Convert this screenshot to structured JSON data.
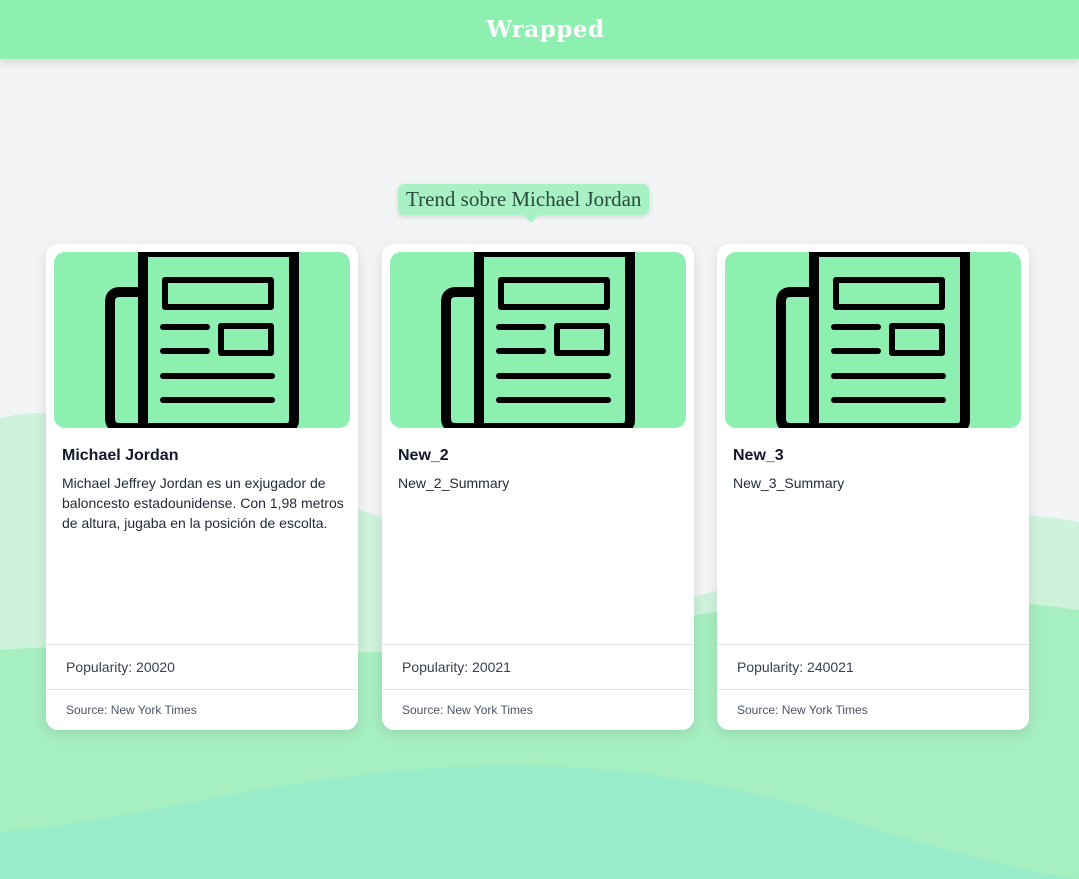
{
  "header": {
    "title": "Wrapped"
  },
  "trend": {
    "label": "Trend sobre Michael Jordan"
  },
  "colors": {
    "accent": "#8ef0b0",
    "bubble": "#a8f1c4",
    "background": "#f3f4f5"
  },
  "cards": [
    {
      "icon": "newspaper-icon",
      "title": "Michael Jordan",
      "summary": "Michael Jeffrey Jordan es un exjugador de baloncesto estadounidense. Con 1,98 metros de altura, jugaba en la posición de escolta.",
      "popularity": "Popularity: 20020",
      "source": "Source: New York Times"
    },
    {
      "icon": "newspaper-icon",
      "title": "New_2",
      "summary": "New_2_Summary",
      "popularity": "Popularity: 20021",
      "source": "Source: New York Times"
    },
    {
      "icon": "newspaper-icon",
      "title": "New_3",
      "summary": "New_3_Summary",
      "popularity": "Popularity: 240021",
      "source": "Source: New York Times"
    }
  ]
}
